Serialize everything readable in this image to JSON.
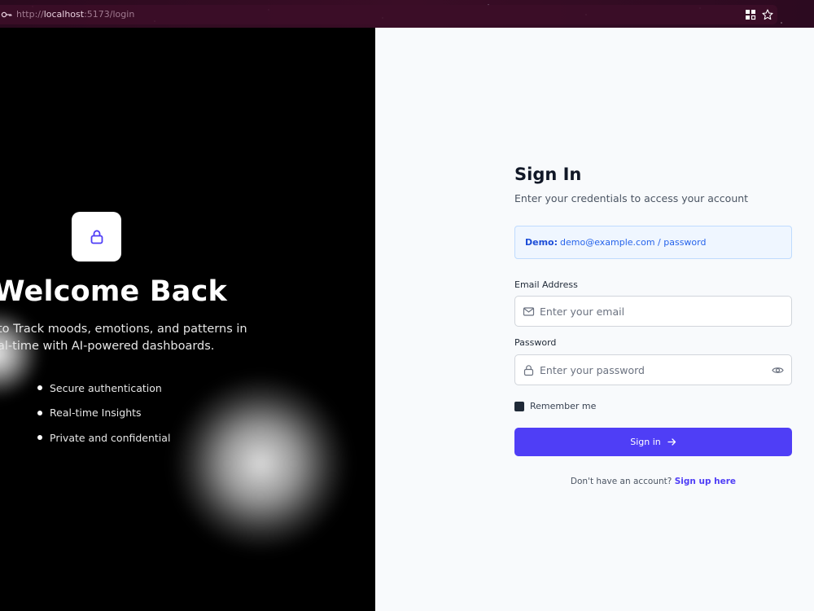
{
  "browser": {
    "url_scheme": "http://",
    "url_host": "localhost",
    "url_path": ":5173/login",
    "icons": [
      "key-icon",
      "extensions-grid-icon",
      "bookmark-star-icon"
    ]
  },
  "hero": {
    "icon": "lock-icon",
    "title": "Welcome Back",
    "subtitle_line1": "to Track moods, emotions, and patterns in",
    "subtitle_line2": "al-time with AI-powered dashboards.",
    "features": [
      {
        "label": "Secure authentication"
      },
      {
        "label": "Real-time Insights"
      },
      {
        "label": "Private and confidential"
      }
    ]
  },
  "form": {
    "title": "Sign In",
    "subtitle": "Enter your credentials to access your account",
    "demo": {
      "label": "Demo:",
      "text": "demo@example.com / password"
    },
    "email": {
      "label": "Email Address",
      "placeholder": "Enter your email",
      "value": "",
      "icon": "mail-icon"
    },
    "password": {
      "label": "Password",
      "placeholder": "Enter your password",
      "value": "",
      "icon": "lock-icon",
      "toggle_icon": "eye-icon"
    },
    "remember_label": "Remember me",
    "submit_label": "Sign in",
    "signup_prompt": "Don't have an account?",
    "signup_link": "Sign up here"
  },
  "colors": {
    "accent": "#4f3ef6",
    "demo_bg": "#eff6ff",
    "demo_text": "#2563eb",
    "panel_bg": "#f8fafc"
  }
}
